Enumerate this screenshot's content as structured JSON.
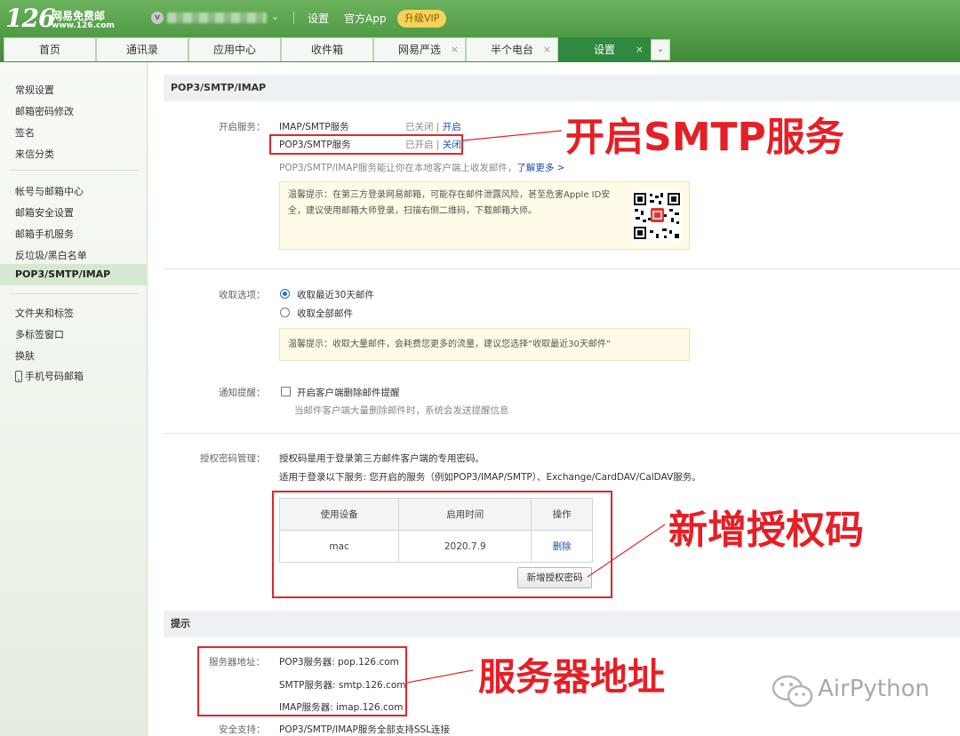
{
  "header": {
    "logo_number": "126",
    "logo_name": "网易免费邮",
    "logo_url": "www.126.com",
    "avatar_letter": "v",
    "links": [
      "设置",
      "官方App"
    ],
    "vip_label": "升级VIP"
  },
  "tabs": [
    {
      "label": "首页",
      "closable": false,
      "active": false
    },
    {
      "label": "通讯录",
      "closable": false,
      "active": false
    },
    {
      "label": "应用中心",
      "closable": false,
      "active": false
    },
    {
      "label": "收件箱",
      "closable": false,
      "active": false
    },
    {
      "label": "网易严选",
      "closable": true,
      "active": false
    },
    {
      "label": "半个电台",
      "closable": true,
      "active": false
    },
    {
      "label": "设置",
      "closable": true,
      "active": true
    }
  ],
  "close_glyph": "×",
  "sidebar": {
    "group1": [
      "常规设置",
      "邮箱密码修改",
      "签名",
      "来信分类"
    ],
    "group2": [
      "帐号与邮箱中心",
      "邮箱安全设置",
      "邮箱手机服务",
      "反垃圾/黑白名单",
      "POP3/SMTP/IMAP"
    ],
    "group3": [
      "文件夹和标签",
      "多标签窗口",
      "换肤",
      "手机号码邮箱"
    ]
  },
  "main": {
    "section_title": "POP3/SMTP/IMAP",
    "enable_service": {
      "label": "开启服务：",
      "rows": [
        {
          "name": "IMAP/SMTP服务",
          "status": "已关闭",
          "action": "开启"
        },
        {
          "name": "POP3/SMTP服务",
          "status": "已开启",
          "action": "关闭"
        }
      ],
      "separator": "|",
      "desc": "POP3/SMTP/IMAP服务能让你在本地客户端上收发邮件，",
      "learn_more": "了解更多 >",
      "tip": "温馨提示：在第三方登录网易邮箱，可能存在邮件泄露风险，甚至危害Apple ID安全，建议使用邮箱大师登录，扫描右侧二维码，下载邮箱大师。"
    },
    "receive": {
      "label": "收取选项：",
      "options": [
        "收取最近30天邮件",
        "收取全部邮件"
      ],
      "selected": 0,
      "tip": "温馨提示：收取大量邮件，会耗费您更多的流量，建议您选择“收取最近30天邮件”"
    },
    "notify": {
      "label": "通知提醒：",
      "checkbox_label": "开启客户端删除邮件提醒",
      "sub": "当邮件客户端大量删除邮件时，系统会发送提醒信息"
    },
    "auth": {
      "label": "授权密码管理：",
      "line1": "授权码是用于登录第三方邮件客户端的专用密码。",
      "line2": "适用于登录以下服务: 您开启的服务（例如POP3/IMAP/SMTP）、Exchange/CardDAV/CalDAV服务。",
      "table_headers": [
        "使用设备",
        "启用时间",
        "操作"
      ],
      "table_rows": [
        [
          "mac",
          "2020.7.9",
          "删除"
        ]
      ],
      "add_button": "新增授权密码"
    },
    "hint_title": "提示",
    "server": {
      "label": "服务器地址：",
      "lines": [
        "POP3服务器: pop.126.com",
        "SMTP服务器: smtp.126.com",
        "IMAP服务器: imap.126.com"
      ],
      "ssl_label": "安全支持：",
      "ssl_text": "POP3/SMTP/IMAP服务全部支持SSL连接"
    }
  },
  "annotations": {
    "smtp": "开启SMTP服务",
    "auth": "新增授权码",
    "server": "服务器地址"
  },
  "watermark": "AirPython"
}
